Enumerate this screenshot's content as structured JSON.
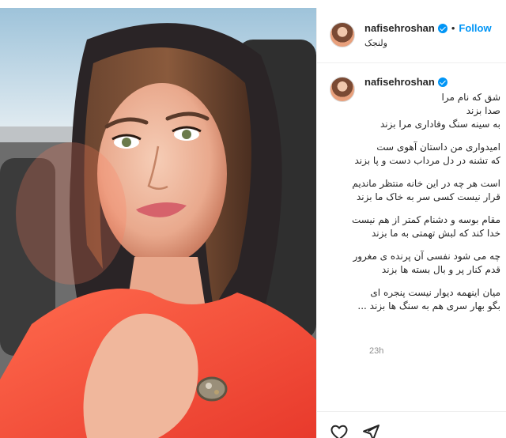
{
  "post": {
    "author": {
      "username": "nafisehroshan",
      "verified": true,
      "follow_label": "Follow",
      "separator": "•",
      "location": "ولنجک"
    },
    "caption_lines": [
      [
        "شق که نام مرا",
        "صدا بزند",
        "به سینه سنگ وفاداری مرا بزند"
      ],
      [
        "امیدواری من داستان آهوی ست",
        "که تشنه در دل مرداب دست و پا بزند"
      ],
      [
        "است هر چه در این خانه منتظر ماندیم",
        "قرار نیست کسی سر به خاک ما بزند"
      ],
      [
        "مقام بوسه و دشنام کمتر از هم نیست",
        "خدا کند که لبش تهمتی به ما بزند"
      ],
      [
        "چه می شود نفسی آن پرنده ی مغرور",
        "قدم کنار پر و بال بسته ها بزند"
      ],
      [
        "میان اینهمه دیوار نیست پنجره ای",
        "بگو بهار سری هم به سنگ ها بزند ..."
      ]
    ],
    "timestamp": "23h"
  },
  "actions": {
    "like_icon": "heart-outline-icon",
    "share_icon": "paper-plane-icon"
  },
  "colors": {
    "accent": "#0095f6",
    "text": "#262626",
    "muted": "#8e8e8e",
    "border": "#efefef"
  }
}
